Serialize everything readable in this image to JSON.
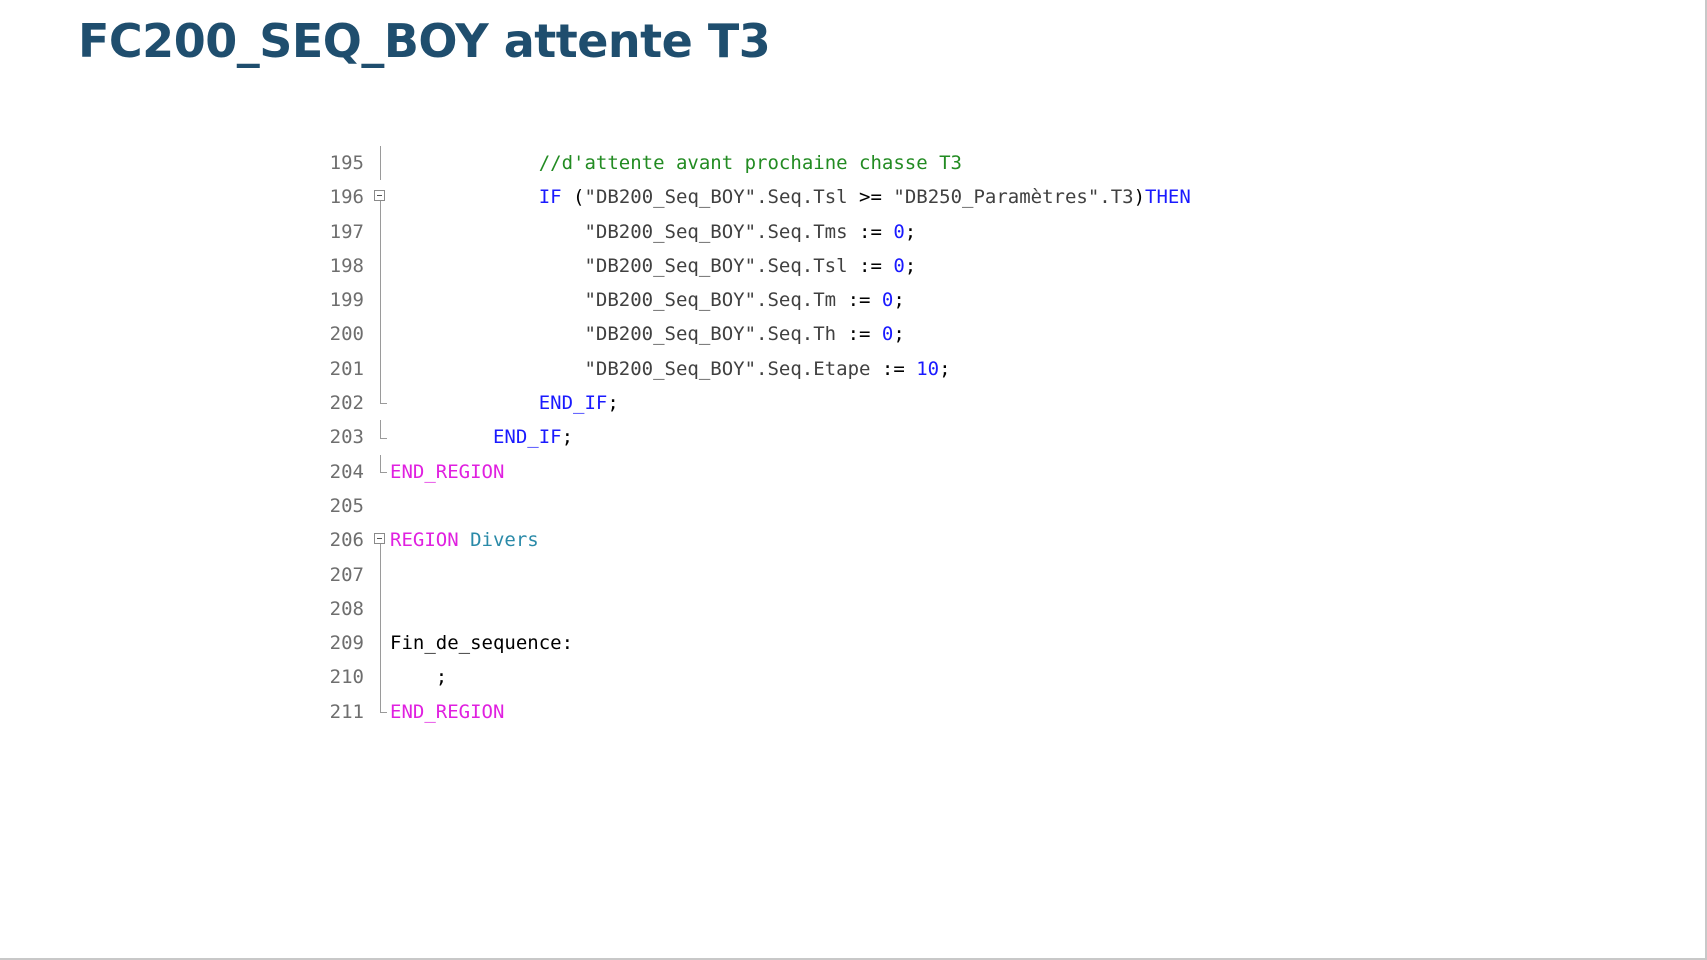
{
  "slide": {
    "title": "FC200_SEQ_BOY attente T3"
  },
  "editor": {
    "lines": [
      {
        "no": "195",
        "indent": "             ",
        "tokens": [
          {
            "type": "comment",
            "text": "//d'attente avant prochaine chasse T3"
          }
        ]
      },
      {
        "no": "196",
        "indent": "             ",
        "tokens": [
          {
            "type": "keyword",
            "text": "IF"
          },
          {
            "type": "op",
            "text": " ("
          },
          {
            "type": "string",
            "text": "\"DB200_Seq_BOY\".Seq.Tsl"
          },
          {
            "type": "op",
            "text": " >= "
          },
          {
            "type": "string",
            "text": "\"DB250_Paramètres\".T3"
          },
          {
            "type": "op",
            "text": ")"
          },
          {
            "type": "keyword",
            "text": "THEN"
          }
        ]
      },
      {
        "no": "197",
        "indent": "                 ",
        "tokens": [
          {
            "type": "string",
            "text": "\"DB200_Seq_BOY\".Seq.Tms"
          },
          {
            "type": "op",
            "text": " := "
          },
          {
            "type": "number",
            "text": "0"
          },
          {
            "type": "op",
            "text": ";"
          }
        ]
      },
      {
        "no": "198",
        "indent": "                 ",
        "tokens": [
          {
            "type": "string",
            "text": "\"DB200_Seq_BOY\".Seq.Tsl"
          },
          {
            "type": "op",
            "text": " := "
          },
          {
            "type": "number",
            "text": "0"
          },
          {
            "type": "op",
            "text": ";"
          }
        ]
      },
      {
        "no": "199",
        "indent": "                 ",
        "tokens": [
          {
            "type": "string",
            "text": "\"DB200_Seq_BOY\".Seq.Tm"
          },
          {
            "type": "op",
            "text": " := "
          },
          {
            "type": "number",
            "text": "0"
          },
          {
            "type": "op",
            "text": ";"
          }
        ]
      },
      {
        "no": "200",
        "indent": "                 ",
        "tokens": [
          {
            "type": "string",
            "text": "\"DB200_Seq_BOY\".Seq.Th"
          },
          {
            "type": "op",
            "text": " := "
          },
          {
            "type": "number",
            "text": "0"
          },
          {
            "type": "op",
            "text": ";"
          }
        ]
      },
      {
        "no": "201",
        "indent": "                 ",
        "tokens": [
          {
            "type": "string",
            "text": "\"DB200_Seq_BOY\".Seq.Etape"
          },
          {
            "type": "op",
            "text": " := "
          },
          {
            "type": "number",
            "text": "10"
          },
          {
            "type": "op",
            "text": ";"
          }
        ]
      },
      {
        "no": "202",
        "indent": "             ",
        "tokens": [
          {
            "type": "keyword",
            "text": "END_IF"
          },
          {
            "type": "op",
            "text": ";"
          }
        ]
      },
      {
        "no": "203",
        "indent": "         ",
        "tokens": [
          {
            "type": "keyword",
            "text": "END_IF"
          },
          {
            "type": "op",
            "text": ";"
          }
        ]
      },
      {
        "no": "204",
        "indent": "",
        "tokens": [
          {
            "type": "region",
            "text": "END_REGION"
          }
        ]
      },
      {
        "no": "205",
        "indent": "",
        "tokens": []
      },
      {
        "no": "206",
        "indent": "",
        "tokens": [
          {
            "type": "region",
            "text": "REGION"
          },
          {
            "type": "op",
            "text": " "
          },
          {
            "type": "regionname",
            "text": "Divers"
          }
        ]
      },
      {
        "no": "207",
        "indent": "",
        "tokens": []
      },
      {
        "no": "208",
        "indent": "",
        "tokens": []
      },
      {
        "no": "209",
        "indent": "",
        "tokens": [
          {
            "type": "plain",
            "text": "Fin_de_sequence:"
          }
        ]
      },
      {
        "no": "210",
        "indent": "    ",
        "tokens": [
          {
            "type": "plain",
            "text": ";"
          }
        ]
      },
      {
        "no": "211",
        "indent": "",
        "tokens": [
          {
            "type": "region",
            "text": "END_REGION"
          }
        ]
      }
    ]
  }
}
